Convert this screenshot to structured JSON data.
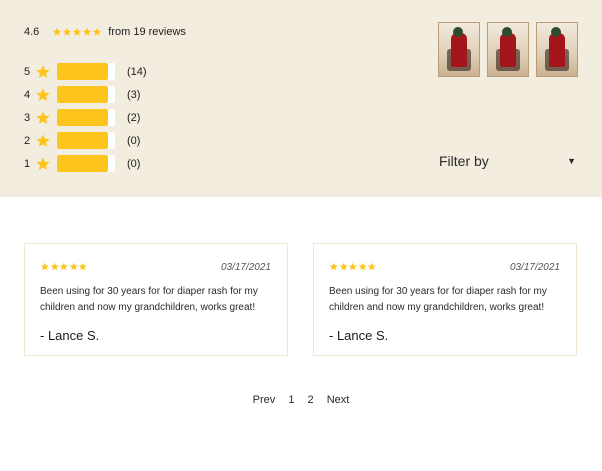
{
  "summary": {
    "average": "4.6",
    "from_text": "from 19 reviews",
    "average_stars": 5,
    "distribution": [
      {
        "stars": "5",
        "count_text": "(14)",
        "fill": 0.88
      },
      {
        "stars": "4",
        "count_text": "(3)",
        "fill": 0.88
      },
      {
        "stars": "3",
        "count_text": "(2)",
        "fill": 0.88
      },
      {
        "stars": "2",
        "count_text": "(0)",
        "fill": 0.88
      },
      {
        "stars": "1",
        "count_text": "(0)",
        "fill": 0.88
      }
    ],
    "filter_label": "Filter by",
    "photo_count": 3
  },
  "reviews": [
    {
      "rating": 5,
      "date": "03/17/2021",
      "text": "Been using for 30 years for for diaper rash for my children and now my grandchildren, works great!",
      "author": "- Lance S."
    },
    {
      "rating": 5,
      "date": "03/17/2021",
      "text": "Been using for 30 years for for diaper rash for my children and now my grandchildren, works great!",
      "author": "- Lance S."
    }
  ],
  "pagination": {
    "prev": "Prev",
    "pages": [
      "1",
      "2"
    ],
    "next": "Next"
  },
  "colors": {
    "summary_bg": "#f3ede0",
    "star": "#fdc51b",
    "bar_fill": "#fdc51b",
    "card_border": "#f0e6d2"
  },
  "icons": {
    "star": "star-icon",
    "caret": "caret-down-icon"
  }
}
